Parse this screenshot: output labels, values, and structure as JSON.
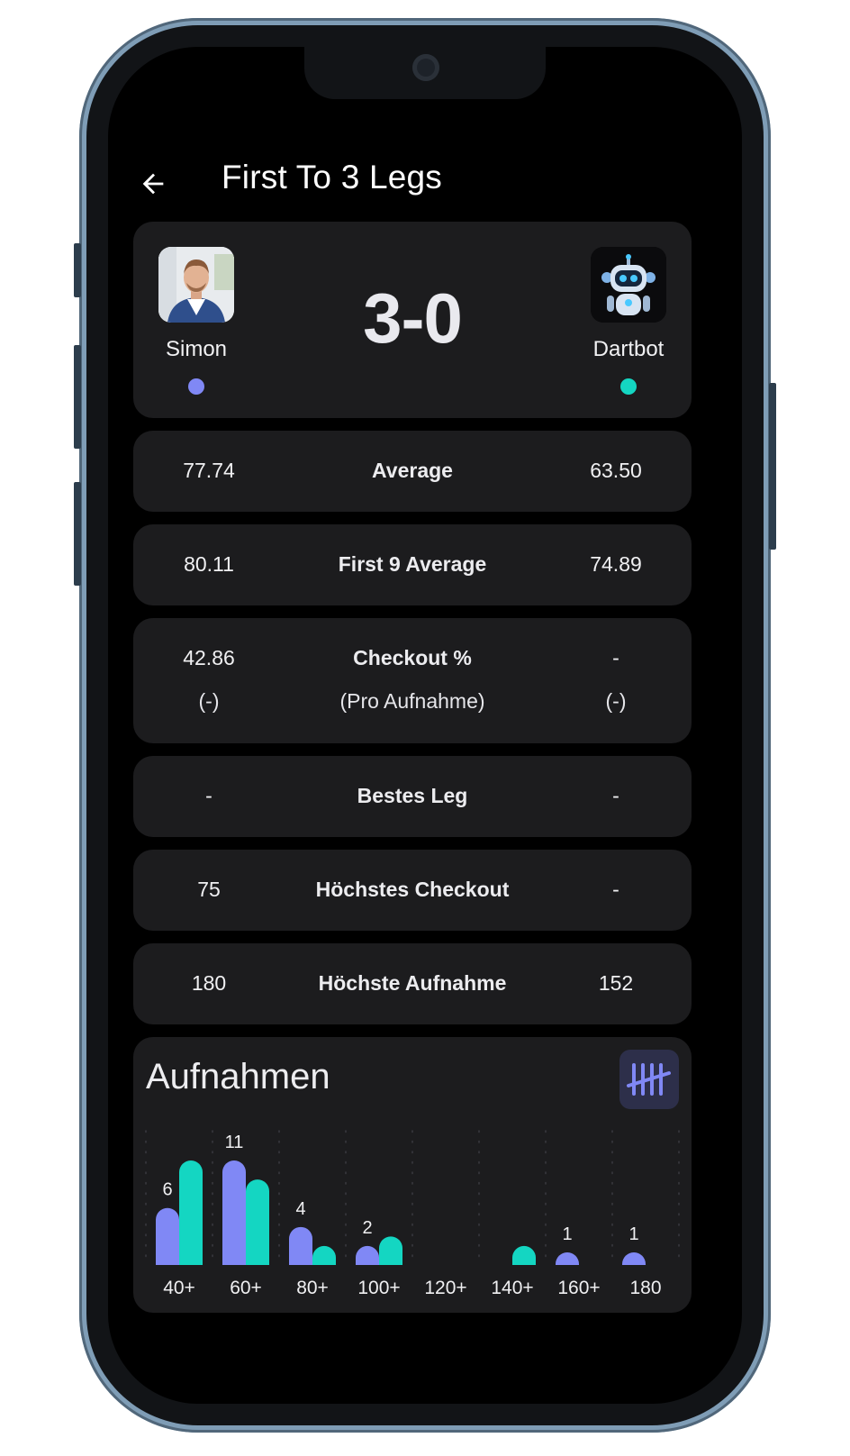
{
  "header": {
    "title": "First To 3 Legs"
  },
  "match": {
    "score": "3-0",
    "player1": {
      "name": "Simon",
      "color": "#8088f5",
      "avatar": "person-photo"
    },
    "player2": {
      "name": "Dartbot",
      "color": "#14d6c2",
      "avatar": "robot-icon"
    }
  },
  "stats": [
    {
      "label": "Average",
      "left": "77.74",
      "right": "63.50"
    },
    {
      "label": "First 9 Average",
      "left": "80.11",
      "right": "74.89"
    },
    {
      "label": "Checkout %",
      "sublabel": "(Pro Aufnahme)",
      "left": "42.86",
      "left_sub": "(-)",
      "right": "-",
      "right_sub": "(-)"
    },
    {
      "label": "Bestes Leg",
      "left": "-",
      "right": "-"
    },
    {
      "label": "Höchstes Checkout",
      "left": "75",
      "right": "-"
    },
    {
      "label": "Höchste Aufnahme",
      "left": "180",
      "right": "152"
    }
  ],
  "aufnahmen": {
    "title": "Aufnahmen",
    "button_icon": "tally-marks-icon",
    "colors": {
      "player1": "#8088f5",
      "player2": "#14d6c2",
      "background": "#1c1c1e",
      "accent_bg": "#2d2f4a"
    }
  },
  "chart_data": {
    "type": "bar",
    "categories": [
      "40+",
      "60+",
      "80+",
      "100+",
      "120+",
      "140+",
      "160+",
      "180"
    ],
    "series": [
      {
        "name": "Simon",
        "values": [
          6,
          11,
          4,
          2,
          0,
          0,
          1,
          1
        ],
        "labels": [
          "6",
          "11",
          "4",
          "2",
          "",
          "",
          "1",
          "1"
        ]
      },
      {
        "name": "Dartbot",
        "values": [
          11,
          9,
          2,
          3,
          0,
          2,
          0,
          0
        ]
      }
    ],
    "ylim": [
      0,
      11
    ],
    "grid": true
  }
}
